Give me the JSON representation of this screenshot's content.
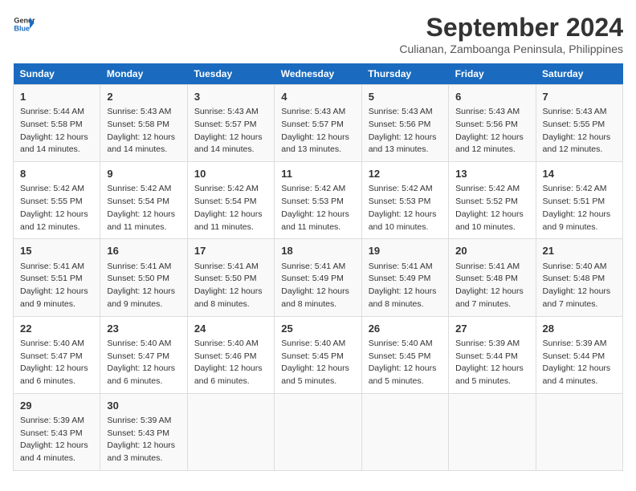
{
  "header": {
    "logo_line1": "General",
    "logo_line2": "Blue",
    "title": "September 2024",
    "subtitle": "Culianan, Zamboanga Peninsula, Philippines"
  },
  "weekdays": [
    "Sunday",
    "Monday",
    "Tuesday",
    "Wednesday",
    "Thursday",
    "Friday",
    "Saturday"
  ],
  "weeks": [
    [
      {
        "day": "1",
        "rise": "5:44 AM",
        "set": "5:58 PM",
        "daylight": "12 hours and 14 minutes."
      },
      {
        "day": "2",
        "rise": "5:43 AM",
        "set": "5:58 PM",
        "daylight": "12 hours and 14 minutes."
      },
      {
        "day": "3",
        "rise": "5:43 AM",
        "set": "5:57 PM",
        "daylight": "12 hours and 14 minutes."
      },
      {
        "day": "4",
        "rise": "5:43 AM",
        "set": "5:57 PM",
        "daylight": "12 hours and 13 minutes."
      },
      {
        "day": "5",
        "rise": "5:43 AM",
        "set": "5:56 PM",
        "daylight": "12 hours and 13 minutes."
      },
      {
        "day": "6",
        "rise": "5:43 AM",
        "set": "5:56 PM",
        "daylight": "12 hours and 12 minutes."
      },
      {
        "day": "7",
        "rise": "5:43 AM",
        "set": "5:55 PM",
        "daylight": "12 hours and 12 minutes."
      }
    ],
    [
      {
        "day": "8",
        "rise": "5:42 AM",
        "set": "5:55 PM",
        "daylight": "12 hours and 12 minutes."
      },
      {
        "day": "9",
        "rise": "5:42 AM",
        "set": "5:54 PM",
        "daylight": "12 hours and 11 minutes."
      },
      {
        "day": "10",
        "rise": "5:42 AM",
        "set": "5:54 PM",
        "daylight": "12 hours and 11 minutes."
      },
      {
        "day": "11",
        "rise": "5:42 AM",
        "set": "5:53 PM",
        "daylight": "12 hours and 11 minutes."
      },
      {
        "day": "12",
        "rise": "5:42 AM",
        "set": "5:53 PM",
        "daylight": "12 hours and 10 minutes."
      },
      {
        "day": "13",
        "rise": "5:42 AM",
        "set": "5:52 PM",
        "daylight": "12 hours and 10 minutes."
      },
      {
        "day": "14",
        "rise": "5:42 AM",
        "set": "5:51 PM",
        "daylight": "12 hours and 9 minutes."
      }
    ],
    [
      {
        "day": "15",
        "rise": "5:41 AM",
        "set": "5:51 PM",
        "daylight": "12 hours and 9 minutes."
      },
      {
        "day": "16",
        "rise": "5:41 AM",
        "set": "5:50 PM",
        "daylight": "12 hours and 9 minutes."
      },
      {
        "day": "17",
        "rise": "5:41 AM",
        "set": "5:50 PM",
        "daylight": "12 hours and 8 minutes."
      },
      {
        "day": "18",
        "rise": "5:41 AM",
        "set": "5:49 PM",
        "daylight": "12 hours and 8 minutes."
      },
      {
        "day": "19",
        "rise": "5:41 AM",
        "set": "5:49 PM",
        "daylight": "12 hours and 8 minutes."
      },
      {
        "day": "20",
        "rise": "5:41 AM",
        "set": "5:48 PM",
        "daylight": "12 hours and 7 minutes."
      },
      {
        "day": "21",
        "rise": "5:40 AM",
        "set": "5:48 PM",
        "daylight": "12 hours and 7 minutes."
      }
    ],
    [
      {
        "day": "22",
        "rise": "5:40 AM",
        "set": "5:47 PM",
        "daylight": "12 hours and 6 minutes."
      },
      {
        "day": "23",
        "rise": "5:40 AM",
        "set": "5:47 PM",
        "daylight": "12 hours and 6 minutes."
      },
      {
        "day": "24",
        "rise": "5:40 AM",
        "set": "5:46 PM",
        "daylight": "12 hours and 6 minutes."
      },
      {
        "day": "25",
        "rise": "5:40 AM",
        "set": "5:45 PM",
        "daylight": "12 hours and 5 minutes."
      },
      {
        "day": "26",
        "rise": "5:40 AM",
        "set": "5:45 PM",
        "daylight": "12 hours and 5 minutes."
      },
      {
        "day": "27",
        "rise": "5:39 AM",
        "set": "5:44 PM",
        "daylight": "12 hours and 5 minutes."
      },
      {
        "day": "28",
        "rise": "5:39 AM",
        "set": "5:44 PM",
        "daylight": "12 hours and 4 minutes."
      }
    ],
    [
      {
        "day": "29",
        "rise": "5:39 AM",
        "set": "5:43 PM",
        "daylight": "12 hours and 4 minutes."
      },
      {
        "day": "30",
        "rise": "5:39 AM",
        "set": "5:43 PM",
        "daylight": "12 hours and 3 minutes."
      },
      null,
      null,
      null,
      null,
      null
    ]
  ]
}
